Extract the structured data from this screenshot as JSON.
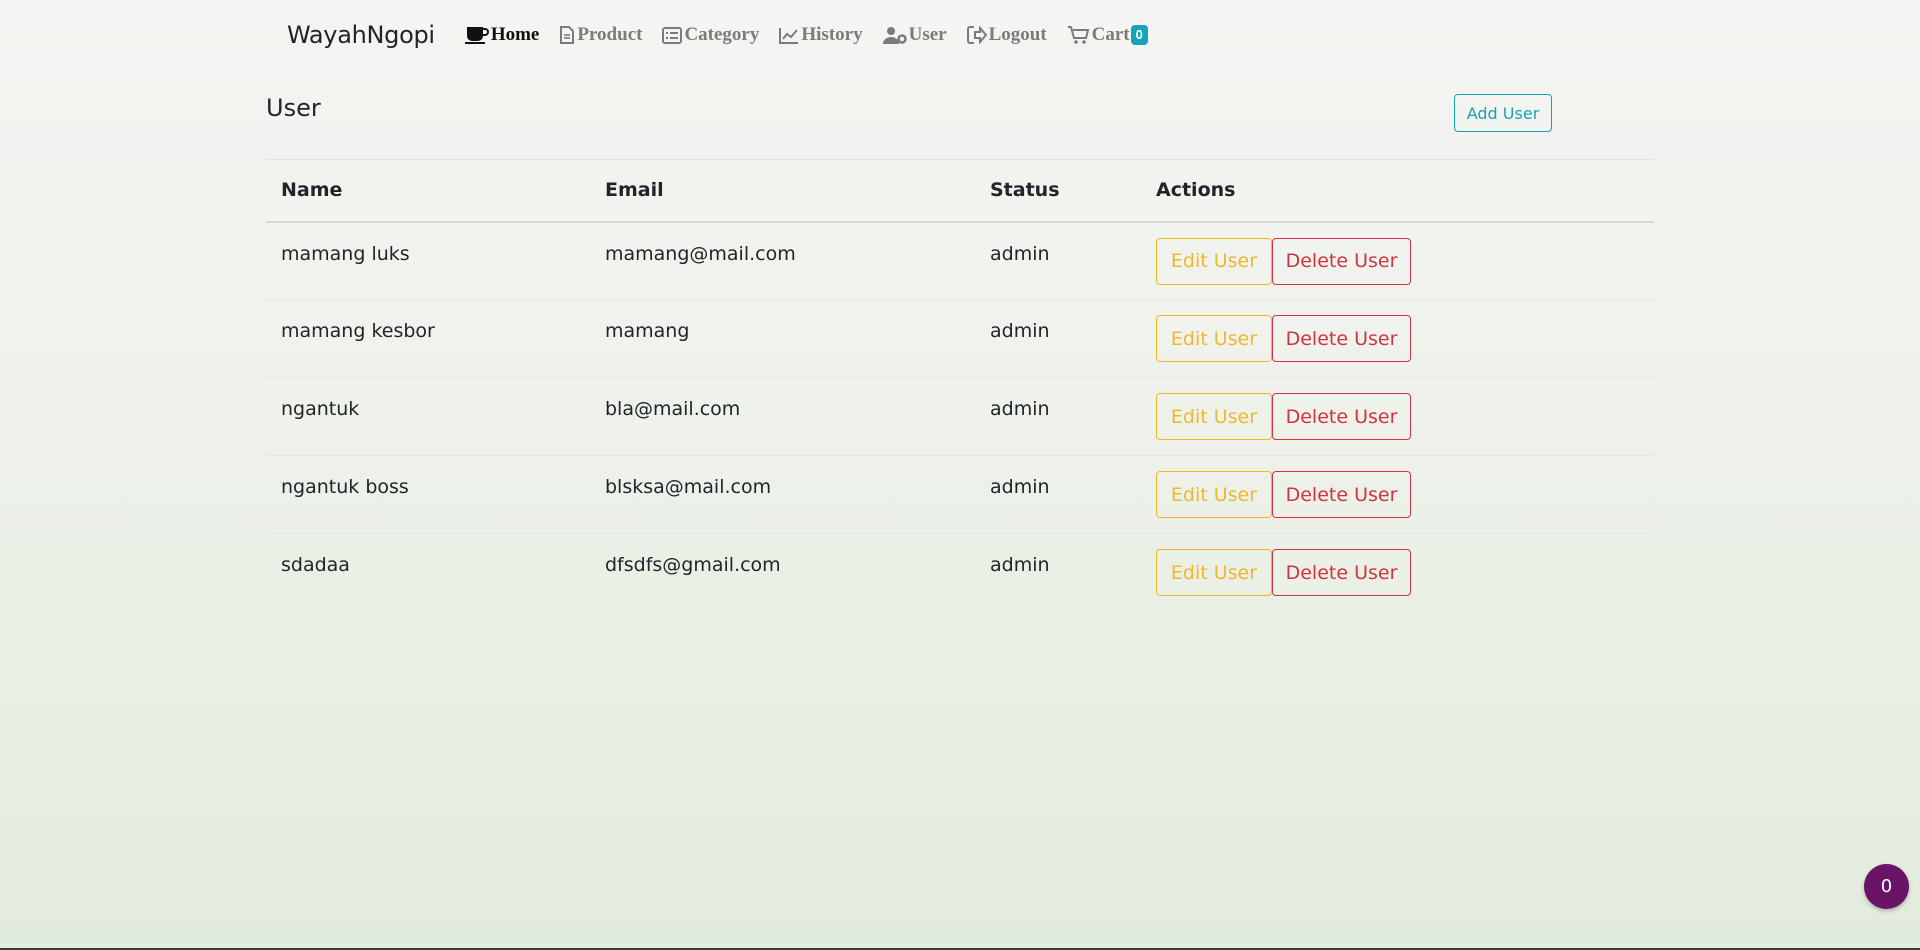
{
  "nav": {
    "brand": "WayahNgopi",
    "items": [
      {
        "label": "Home",
        "icon": "coffee-icon",
        "active": true
      },
      {
        "label": "Product",
        "icon": "file-icon"
      },
      {
        "label": "Category",
        "icon": "list-icon"
      },
      {
        "label": "History",
        "icon": "chart-line-icon"
      },
      {
        "label": "User",
        "icon": "user-gear-icon"
      },
      {
        "label": "Logout",
        "icon": "logout-icon"
      },
      {
        "label": "Cart",
        "icon": "cart-icon"
      }
    ],
    "cart_count": "0"
  },
  "page": {
    "title": "User",
    "add_button": "Add User"
  },
  "table": {
    "headers": [
      "Name",
      "Email",
      "Status",
      "Actions"
    ],
    "rows": [
      {
        "name": "mamang luks",
        "email": "mamang@mail.com",
        "status": "admin"
      },
      {
        "name": "mamang kesbor",
        "email": "mamang",
        "status": "admin"
      },
      {
        "name": "ngantuk",
        "email": "bla@mail.com",
        "status": "admin"
      },
      {
        "name": "ngantuk boss",
        "email": "blsksa@mail.com",
        "status": "admin"
      },
      {
        "name": "sdadaa",
        "email": "dfsdfs@gmail.com",
        "status": "admin"
      }
    ],
    "edit_label": "Edit User",
    "delete_label": "Delete User"
  },
  "fab": {
    "label": "0"
  },
  "colors": {
    "info": "#17a2b8",
    "warning": "#f0b72a",
    "danger": "#d0343f",
    "fab": "#6a1468"
  }
}
